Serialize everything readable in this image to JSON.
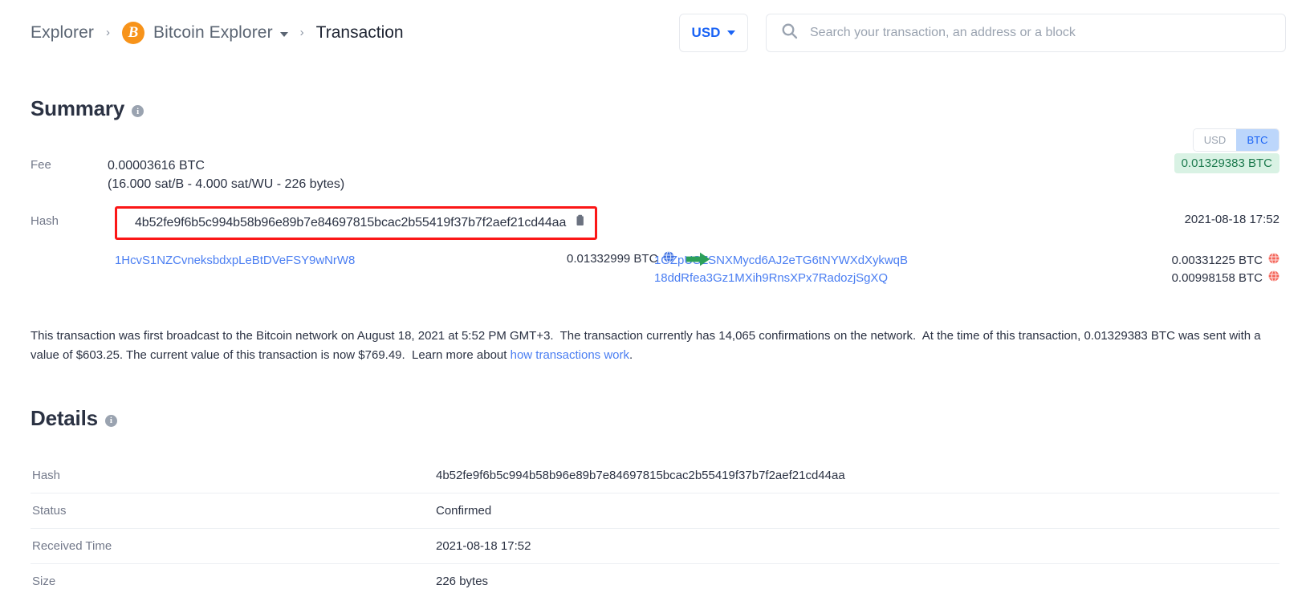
{
  "header": {
    "breadcrumb": {
      "root": "Explorer",
      "separator": "›",
      "chain": "Bitcoin Explorer",
      "chain_logo": "bitcoin-logo-icon",
      "current": "Transaction"
    },
    "currency_selector": {
      "value": "USD",
      "icon": "chevron-down-icon"
    },
    "search": {
      "icon": "search-icon",
      "placeholder": "Search your transaction, an address or a block",
      "value": ""
    }
  },
  "summary": {
    "title": "Summary",
    "info_icon": "info-icon",
    "unit_toggle": {
      "options": [
        "USD",
        "BTC"
      ],
      "selected": "BTC"
    },
    "fee": {
      "label": "Fee",
      "amount": "0.00003616 BTC",
      "detail": "(16.000 sat/B - 4.000 sat/WU - 226 bytes)",
      "badge_value": "0.01329383 BTC",
      "badge_color": "#d9f2e4",
      "badge_text_color": "#1d7a4e"
    },
    "hash_row": {
      "label": "Hash",
      "value": "4b52fe9f6b5c994b58b96e89b7e84697815bcac2b55419f37b7f2aef21cd44aa",
      "copy_icon": "clipboard-copy-icon",
      "highlight_color": "#fb1717",
      "timestamp": "2021-08-18 17:52"
    },
    "flow": {
      "arrow_icon": "arrow-right-icon",
      "arrow_color": "#2ca05a",
      "inputs": [
        {
          "address": "1HcvS1NZCvneksbdxpLeBtDVeFSY9wNrW8",
          "amount": "0.01332999 BTC",
          "globe_icon": "globe-icon",
          "globe_color": "#3d6fe0"
        }
      ],
      "outputs": [
        {
          "address": "1GZpUSZSNXMycd6AJ2eTG6tNYWXdXykwqB",
          "amount": "0.00331225 BTC",
          "globe_icon": "globe-icon",
          "globe_color": "#f4655a"
        },
        {
          "address": "18ddRfea3Gz1MXih9RnsXPx7RadozjSgXQ",
          "amount": "0.00998158 BTC",
          "globe_icon": "globe-icon",
          "globe_color": "#f4655a"
        }
      ]
    },
    "description": {
      "part1": "This transaction was first broadcast to the Bitcoin network on August 18, 2021 at 5:52 PM GMT+3.  The transaction currently has 14,065 confirmations on the network.  At the time of this transaction, 0.01329383 BTC was sent with a value of $603.25. The current value of this transaction is now $769.49.  Learn more about ",
      "link": "how transactions work",
      "part2": "."
    }
  },
  "details": {
    "title": "Details",
    "info_icon": "info-icon",
    "rows": [
      {
        "key": "Hash",
        "value": "4b52fe9f6b5c994b58b96e89b7e84697815bcac2b55419f37b7f2aef21cd44aa",
        "type": "text"
      },
      {
        "key": "Status",
        "value": "Confirmed",
        "type": "status"
      },
      {
        "key": "Received Time",
        "value": "2021-08-18 17:52",
        "type": "text"
      },
      {
        "key": "Size",
        "value": "226 bytes",
        "type": "text"
      }
    ]
  }
}
